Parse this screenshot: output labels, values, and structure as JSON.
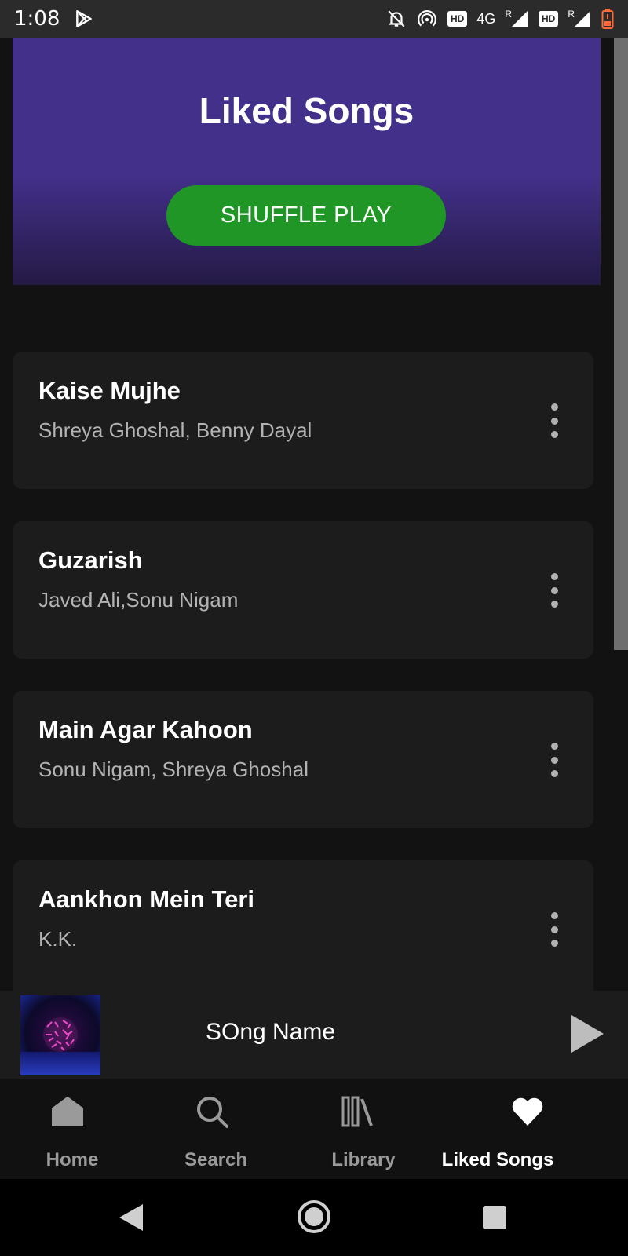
{
  "status_bar": {
    "time": "1:08",
    "network": "4G",
    "hd_label": "HD",
    "roaming": "R",
    "icons": [
      "play-store-icon",
      "mute-bell-icon",
      "hotspot-icon",
      "signal-icon",
      "battery-low-icon"
    ]
  },
  "header": {
    "title": "Liked Songs",
    "shuffle_label": "SHUFFLE PLAY"
  },
  "songs": [
    {
      "title": "Kaise Mujhe",
      "artist": "Shreya Ghoshal, Benny Dayal"
    },
    {
      "title": "Guzarish",
      "artist": "Javed Ali,Sonu Nigam"
    },
    {
      "title": "Main Agar Kahoon",
      "artist": "Sonu Nigam, Shreya Ghoshal"
    },
    {
      "title": "Aankhon Mein Teri",
      "artist": "K.K."
    }
  ],
  "mini_player": {
    "song_name": "SOng Name"
  },
  "nav": {
    "items": [
      {
        "label": "Home",
        "icon": "home-icon"
      },
      {
        "label": "Search",
        "icon": "search-icon"
      },
      {
        "label": "Library",
        "icon": "library-icon"
      },
      {
        "label": "Liked Songs",
        "icon": "heart-icon"
      }
    ],
    "active_index": 3
  },
  "colors": {
    "accent": "#1f9626",
    "hero": "#43308b",
    "background": "#121212",
    "card": "#1c1c1c"
  }
}
